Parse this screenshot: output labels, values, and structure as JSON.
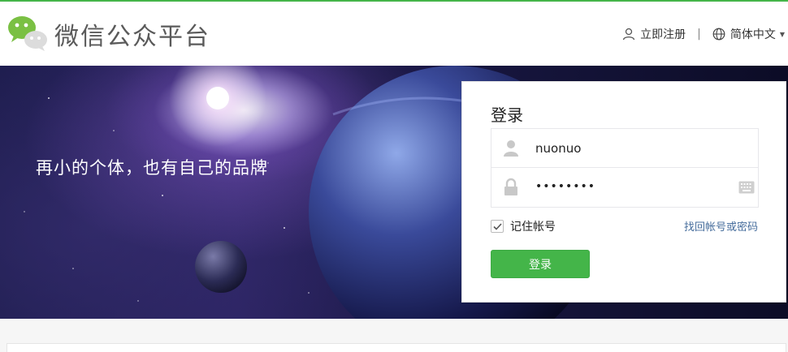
{
  "header": {
    "brand_name": "微信公众平台",
    "register_label": "立即注册",
    "separator": "|",
    "language_label": "简体中文",
    "icons": {
      "logo": "wechat-logo-icon",
      "user": "user-icon",
      "globe": "globe-icon",
      "caret": "caret-down-icon"
    }
  },
  "banner": {
    "tagline": "再小的个体，也有自己的品牌"
  },
  "login": {
    "title": "登录",
    "username_value": "nuonuo",
    "password_value": "••••••••",
    "remember_label": "记住帐号",
    "remember_checked": true,
    "forgot_label": "找回帐号或密码",
    "submit_label": "登录",
    "icons": {
      "user": "person-icon",
      "lock": "lock-icon",
      "keyboard": "keyboard-icon",
      "check": "checkmark-icon"
    }
  },
  "colors": {
    "accent": "#44b549",
    "link": "#466d9c",
    "banner_dark": "#1b1b4a"
  }
}
